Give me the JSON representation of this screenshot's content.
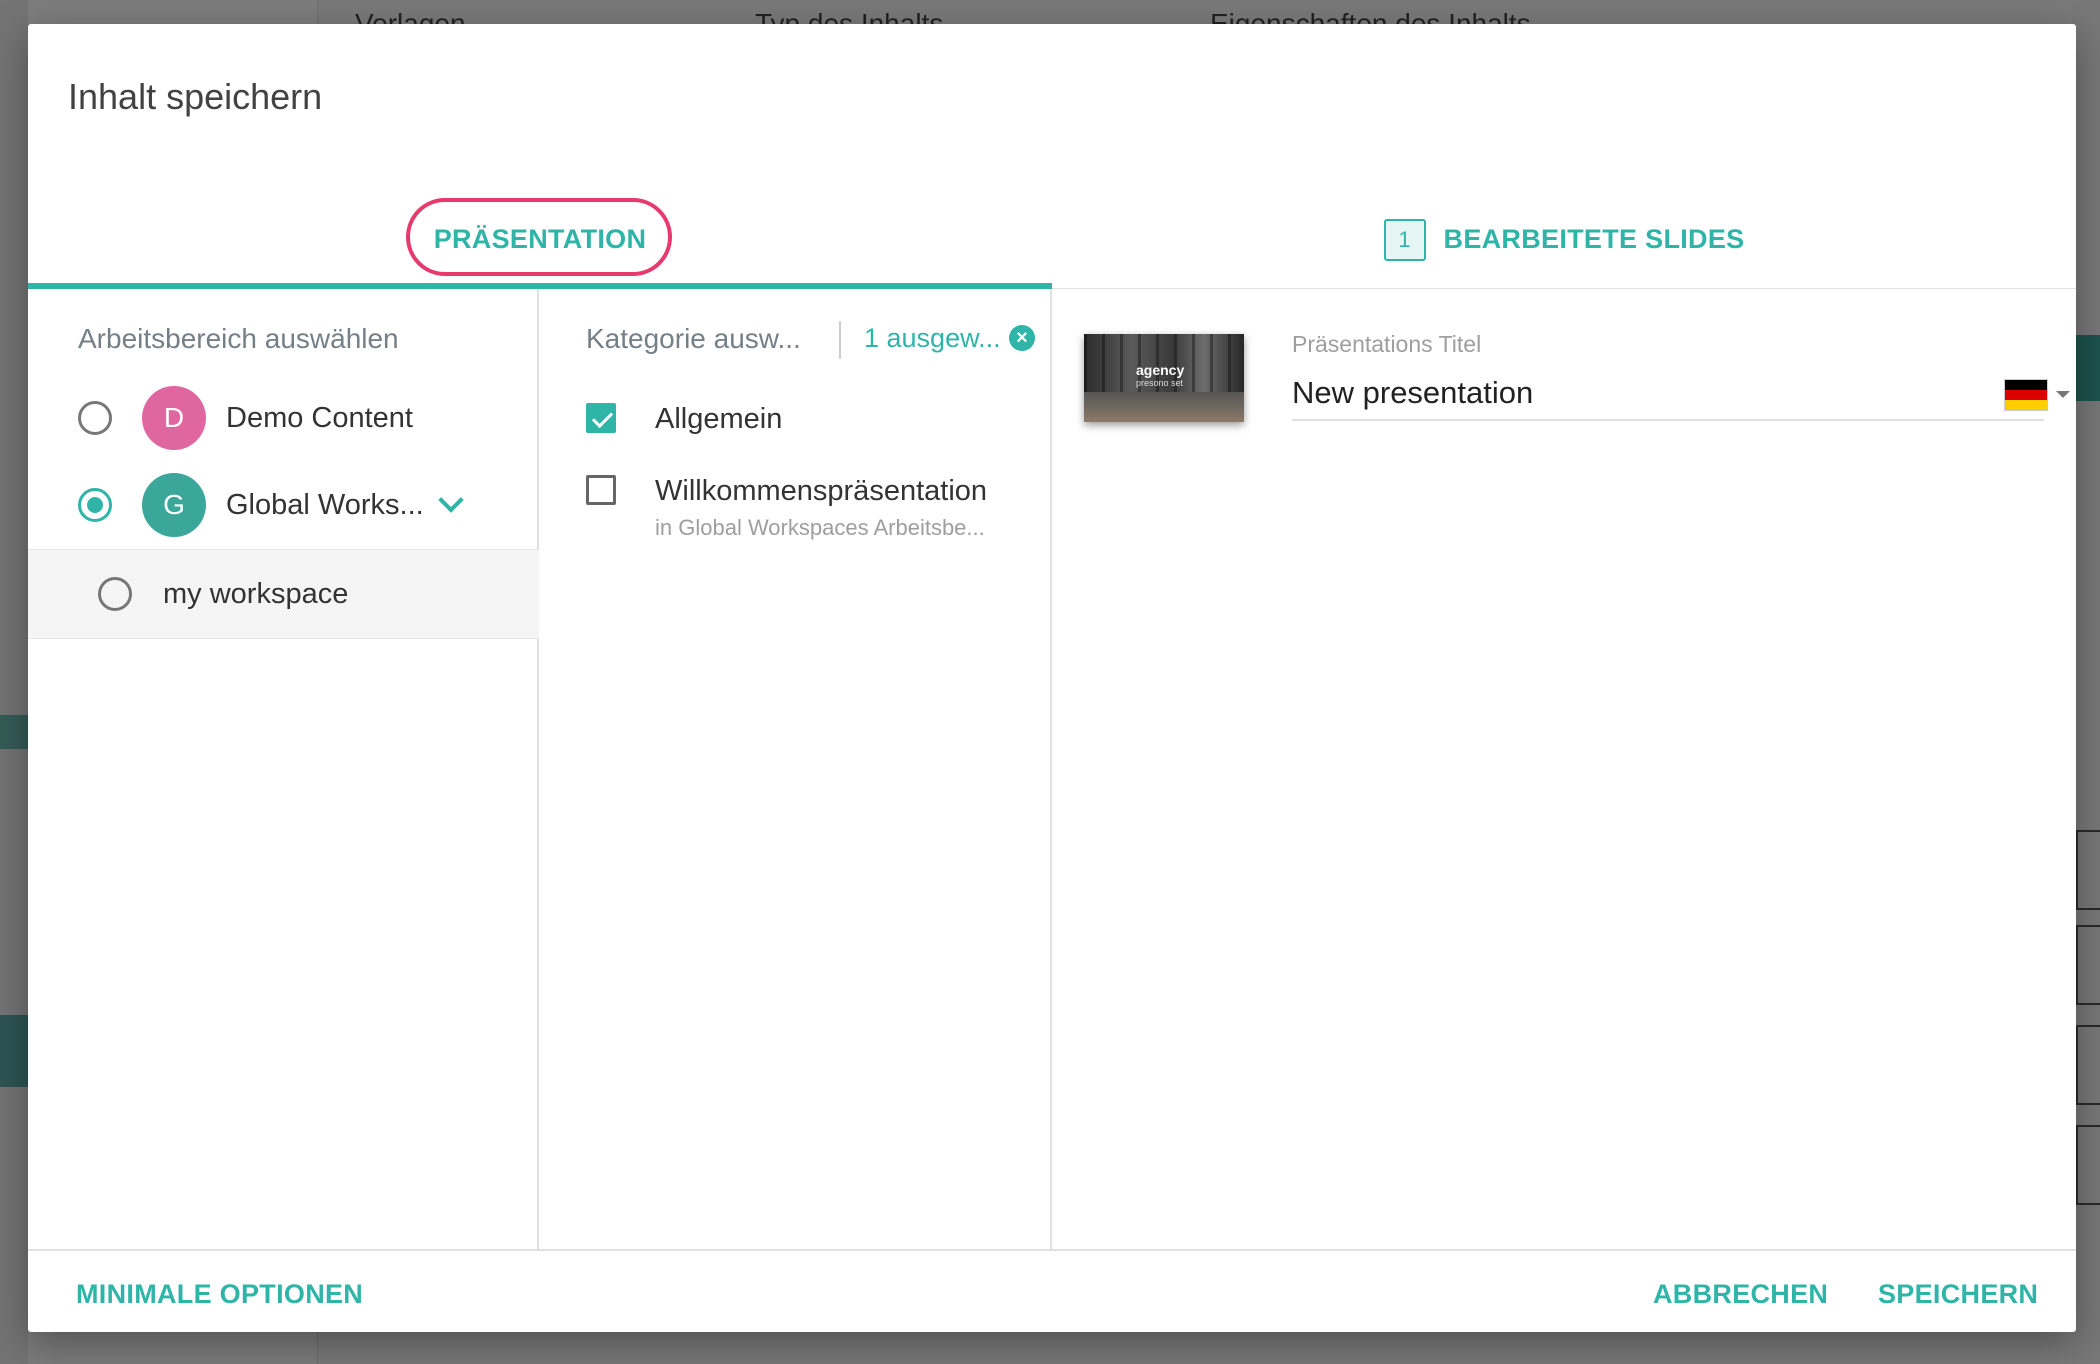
{
  "background": {
    "header_items": [
      "Vorlagen",
      "Typ des Inhalts",
      "Eigenschaften des Inhalts"
    ]
  },
  "dialog": {
    "title": "Inhalt speichern",
    "tabs": {
      "presentation": "PRÄSENTATION",
      "edited_slides": "BEARBEITETE SLIDES",
      "edited_slides_count": "1"
    },
    "workspace": {
      "heading": "Arbeitsbereich auswählen",
      "items": [
        {
          "initial": "D",
          "name": "Demo Content",
          "color": "#e0669f",
          "selected": false
        },
        {
          "initial": "G",
          "name": "Global Works...",
          "color": "#3aa79a",
          "selected": true
        }
      ],
      "sub_items": [
        {
          "name": "my workspace",
          "selected": false
        }
      ]
    },
    "category": {
      "heading": "Kategorie ausw...",
      "selected_count": "1 ausgew...",
      "items": [
        {
          "label": "Allgemein",
          "checked": true,
          "sub": ""
        },
        {
          "label": "Willkommenspräsentation",
          "checked": false,
          "sub": "in Global Workspaces Arbeitsbe..."
        }
      ]
    },
    "presentation": {
      "thumbnail_title": "agency",
      "thumbnail_subtitle": "presono set",
      "title_label": "Präsentations Titel",
      "title_value": "New presentation",
      "language_flag": "de-flag-icon"
    },
    "footer": {
      "minimal_options": "MINIMALE OPTIONEN",
      "cancel": "ABBRECHEN",
      "save": "SPEICHERN"
    }
  },
  "colors": {
    "accent": "#2fb5a8",
    "highlight_circle": "#e8396f"
  }
}
